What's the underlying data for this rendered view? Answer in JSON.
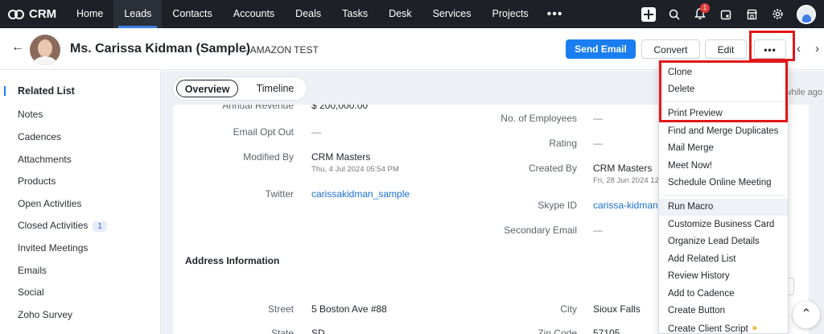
{
  "topnav": {
    "brand": "CRM",
    "items": [
      "Home",
      "Leads",
      "Contacts",
      "Accounts",
      "Deals",
      "Tasks",
      "Desk",
      "Services",
      "Projects"
    ],
    "more": "•••",
    "notification_count": "1"
  },
  "record": {
    "title": "Ms. Carissa Kidman (Sample)",
    "subtitle": "- AMAZON TEST",
    "send_email": "Send Email",
    "convert": "Convert",
    "edit": "Edit",
    "more": "•••"
  },
  "sidebar": {
    "title": "Related List",
    "items": [
      "Notes",
      "Cadences",
      "Attachments",
      "Products",
      "Open Activities",
      "Closed Activities",
      "Invited Meetings",
      "Emails",
      "Social",
      "Zoho Survey"
    ],
    "closed_activities_count": "1"
  },
  "tabs": {
    "overview": "Overview",
    "timeline": "Timeline",
    "updated": "while ago"
  },
  "details": {
    "annual_revenue_label": "Annual Revenue",
    "annual_revenue": "$ 200,000.00",
    "email_opt_out_label": "Email Opt Out",
    "email_opt_out": "—",
    "modified_by_label": "Modified By",
    "modified_by": "CRM Masters",
    "modified_time": "Thu, 4 Jul 2024 05:54 PM",
    "twitter_label": "Twitter",
    "twitter": "carissakidman_sample",
    "employees_label": "No. of Employees",
    "employees": "—",
    "rating_label": "Rating",
    "rating": "—",
    "created_by_label": "Created By",
    "created_by": "CRM Masters",
    "created_time": "Fri, 28 Jun 2024 12:",
    "skype_label": "Skype ID",
    "skype": "carissa-kidman",
    "secondary_email_label": "Secondary Email",
    "secondary_email": "—",
    "address_section": "Address Information",
    "street_label": "Street",
    "street": "5 Boston Ave #88",
    "city_label": "City",
    "city": "Sioux Falls",
    "state_label": "State",
    "state": "SD",
    "zip_label": "Zip Code",
    "zip": "57105"
  },
  "menu": {
    "items": [
      "Clone",
      "Delete",
      "Print Preview",
      "Find and Merge Duplicates",
      "Mail Merge",
      "Meet Now!",
      "Schedule Online Meeting",
      "Run Macro",
      "Customize Business Card",
      "Organize Lead Details",
      "Add Related List",
      "Review History",
      "Add to Cadence",
      "Create Button",
      "Create Client Script"
    ]
  }
}
